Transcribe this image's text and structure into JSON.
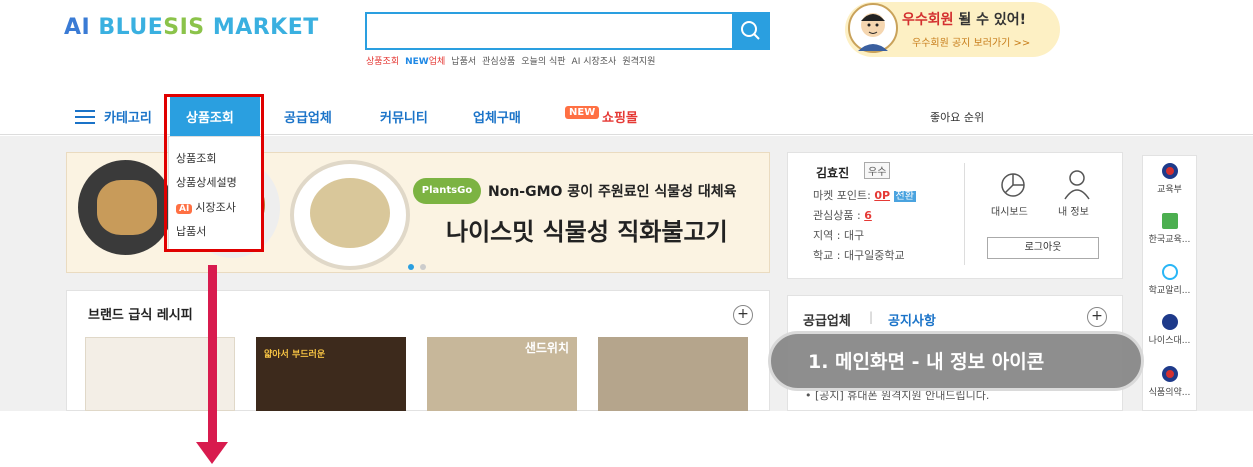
{
  "header": {
    "logo": {
      "p1": "AI ",
      "p2": "BLUE",
      "p3": "SIS",
      "p4": " MARKET"
    },
    "search_placeholder": "",
    "keywords": [
      "상품조회",
      "NEW",
      "업체",
      "납품서",
      "관심상품",
      "오늘의 식판",
      "AI 시장조사",
      "원격지원"
    ],
    "promo_title": "우수회원",
    "promo_title_tail": " 될 수 있어!",
    "promo_sub": "우수회원 공지 보러가기 >>"
  },
  "nav": {
    "category": "카테고리",
    "active": "상품조회",
    "items": [
      "공급업체",
      "커뮤니티",
      "업체구매"
    ],
    "new_badge": "NEW",
    "shop": "쇼핑몰",
    "likes": "좋아요 순위"
  },
  "dropdown": {
    "items": [
      "상품조회",
      "상품상세설명",
      "시장조사",
      "납품서"
    ],
    "ai_badge": "AI"
  },
  "banner": {
    "logo": "PlantsGo",
    "subtitle": "Non-GMO 콩이 주원료인 식물성 대체육",
    "title": "나이스밋 식물성 직화불고기"
  },
  "recipe": {
    "title": "브랜드 급식 레시피",
    "thumb_texts": [
      "",
      "얇아서 부드러운",
      "샌드위치",
      ""
    ],
    "plus": "+"
  },
  "user": {
    "name": "김효진",
    "grade": "우수",
    "points_label": "마켓 포인트: ",
    "points_value": "0P",
    "points_badge": "전환",
    "interest_label": "관심상품 : ",
    "interest_value": "6",
    "region": "지역 : 대구",
    "school": "학교 : 대구일중학교",
    "dashboard": "대시보드",
    "myinfo": "내 정보",
    "logout": "로그아웃"
  },
  "notice": {
    "tab1": "공급업체",
    "sep": "|",
    "tab2": "공지사항",
    "line": "• [공지] 휴대폰 원격지원 안내드립니다.",
    "plus": "+"
  },
  "callout": "1. 메인화면 - 내 정보 아이콘",
  "sidebar": [
    "교육부",
    "한국교육...",
    "학교알리...",
    "나이스대...",
    "식품의약..."
  ],
  "colors": {
    "accent": "#2a9fe0",
    "highlight": "#e00000",
    "arrow": "#d81b4e"
  }
}
